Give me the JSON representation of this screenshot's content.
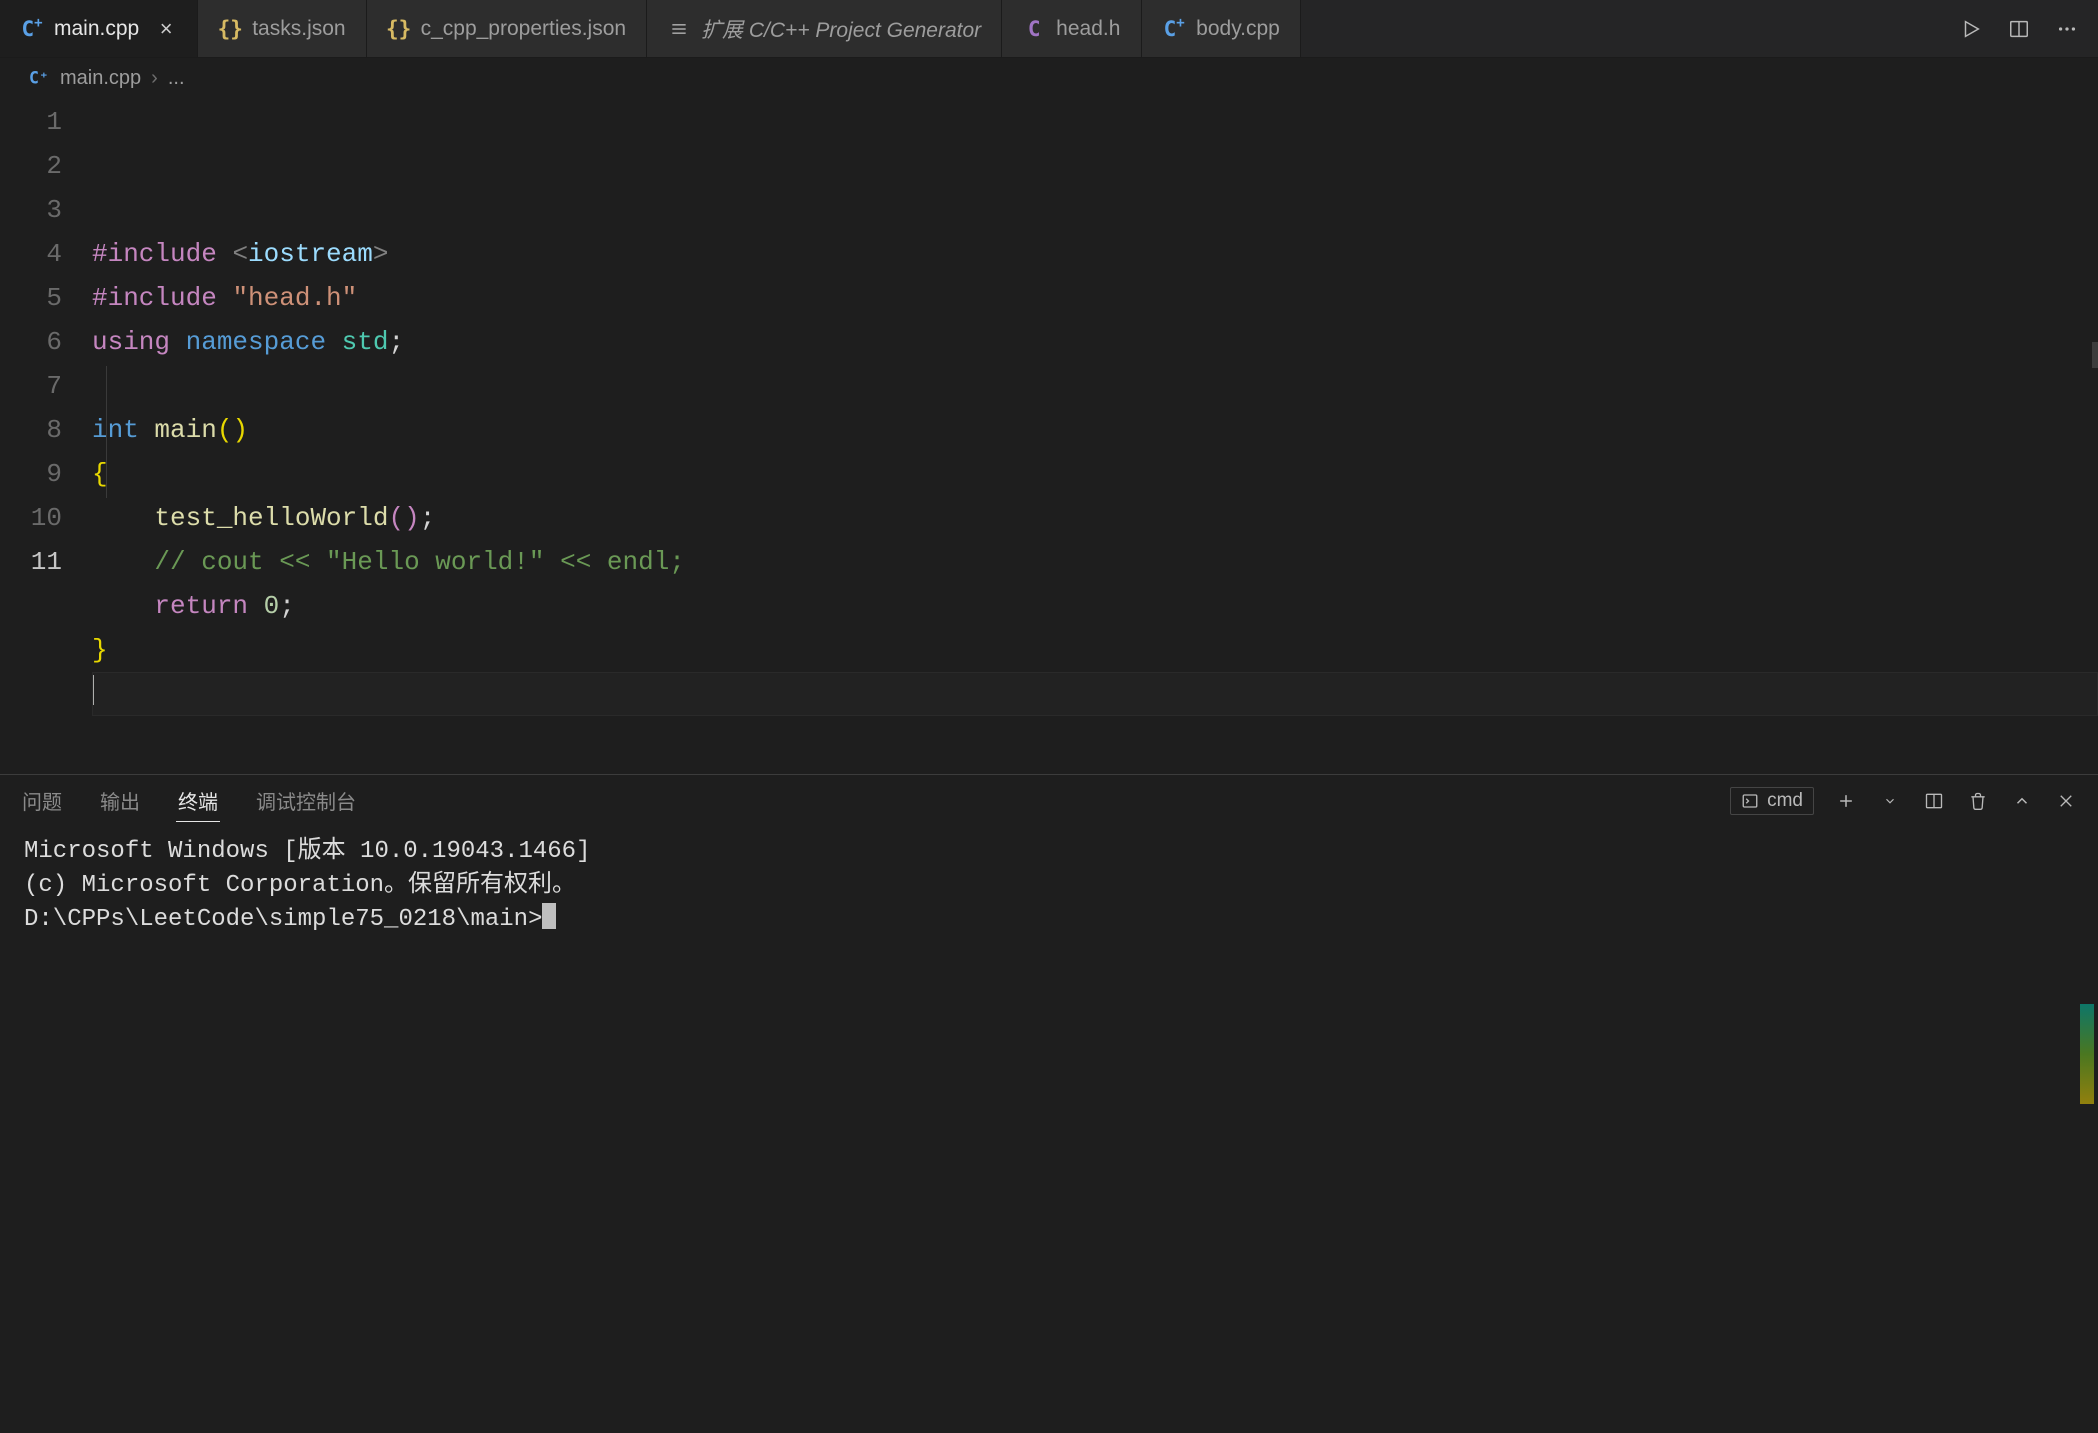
{
  "tabs": [
    {
      "label": "main.cpp",
      "icon": "cpp",
      "active": true,
      "italic": false,
      "closeable": true
    },
    {
      "label": "tasks.json",
      "icon": "json",
      "active": false,
      "italic": false,
      "closeable": false
    },
    {
      "label": "c_cpp_properties.json",
      "icon": "json",
      "active": false,
      "italic": false,
      "closeable": false
    },
    {
      "label": "扩展 C/C++ Project Generator",
      "icon": "ext",
      "active": false,
      "italic": true,
      "closeable": false
    },
    {
      "label": "head.h",
      "icon": "h",
      "active": false,
      "italic": false,
      "closeable": false
    },
    {
      "label": "body.cpp",
      "icon": "cpp",
      "active": false,
      "italic": false,
      "closeable": false
    }
  ],
  "breadcrumb": {
    "file": "main.cpp",
    "trail": "..."
  },
  "editor": {
    "line_count": 11,
    "current_line": 11,
    "lines": [
      [
        {
          "c": "tok-pp",
          "t": "#include"
        },
        {
          "c": "",
          "t": " "
        },
        {
          "c": "tok-angleb",
          "t": "<"
        },
        {
          "c": "tok-angle",
          "t": "iostream"
        },
        {
          "c": "tok-angleb",
          "t": ">"
        }
      ],
      [
        {
          "c": "tok-pp",
          "t": "#include"
        },
        {
          "c": "",
          "t": " "
        },
        {
          "c": "tok-str",
          "t": "\"head.h\""
        }
      ],
      [
        {
          "c": "tok-pp",
          "t": "using"
        },
        {
          "c": "",
          "t": " "
        },
        {
          "c": "tok-kw",
          "t": "namespace"
        },
        {
          "c": "",
          "t": " "
        },
        {
          "c": "tok-type",
          "t": "std"
        },
        {
          "c": "tok-punc",
          "t": ";"
        }
      ],
      [],
      [
        {
          "c": "tok-kw",
          "t": "int"
        },
        {
          "c": "",
          "t": " "
        },
        {
          "c": "tok-fn",
          "t": "main"
        },
        {
          "c": "tok-brace-y",
          "t": "()"
        }
      ],
      [
        {
          "c": "tok-brace-y",
          "t": "{"
        }
      ],
      [
        {
          "c": "",
          "t": "    "
        },
        {
          "c": "tok-fn",
          "t": "test_helloWorld"
        },
        {
          "c": "tok-brace-p",
          "t": "()"
        },
        {
          "c": "tok-punc",
          "t": ";"
        }
      ],
      [
        {
          "c": "",
          "t": "    "
        },
        {
          "c": "tok-comment",
          "t": "// cout << \"Hello world!\" << endl;"
        }
      ],
      [
        {
          "c": "",
          "t": "    "
        },
        {
          "c": "tok-pp",
          "t": "return"
        },
        {
          "c": "",
          "t": " "
        },
        {
          "c": "tok-num",
          "t": "0"
        },
        {
          "c": "tok-punc",
          "t": ";"
        }
      ],
      [
        {
          "c": "tok-brace-y",
          "t": "}"
        }
      ],
      []
    ]
  },
  "panel": {
    "tabs": [
      "问题",
      "输出",
      "终端",
      "调试控制台"
    ],
    "active": 2,
    "shell_label": "cmd",
    "terminal_lines": [
      "Microsoft Windows [版本 10.0.19043.1466]",
      "(c) Microsoft Corporation。保留所有权利。",
      "",
      "D:\\CPPs\\LeetCode\\simple75_0218\\main>"
    ]
  }
}
